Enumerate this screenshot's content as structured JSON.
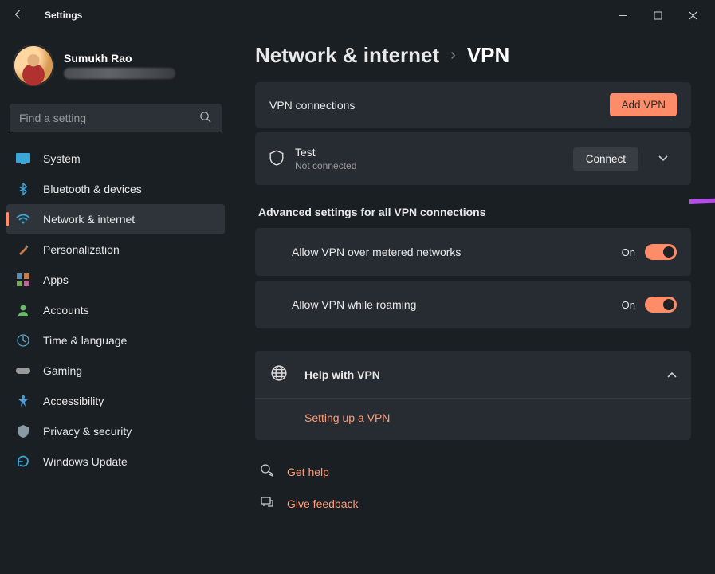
{
  "window": {
    "title": "Settings"
  },
  "profile": {
    "name": "Sumukh Rao"
  },
  "search": {
    "placeholder": "Find a setting"
  },
  "sidebar": {
    "items": [
      {
        "label": "System",
        "icon": "monitor"
      },
      {
        "label": "Bluetooth & devices",
        "icon": "bluetooth"
      },
      {
        "label": "Network & internet",
        "icon": "wifi",
        "active": true
      },
      {
        "label": "Personalization",
        "icon": "brush"
      },
      {
        "label": "Apps",
        "icon": "apps"
      },
      {
        "label": "Accounts",
        "icon": "person"
      },
      {
        "label": "Time & language",
        "icon": "globe"
      },
      {
        "label": "Gaming",
        "icon": "gamepad"
      },
      {
        "label": "Accessibility",
        "icon": "accessibility"
      },
      {
        "label": "Privacy & security",
        "icon": "shield"
      },
      {
        "label": "Windows Update",
        "icon": "update"
      }
    ]
  },
  "breadcrumb": {
    "parent": "Network & internet",
    "current": "VPN"
  },
  "vpn": {
    "connections_header": "VPN connections",
    "add_button": "Add VPN",
    "item": {
      "name": "Test",
      "status": "Not connected",
      "connect_label": "Connect"
    }
  },
  "advanced": {
    "title": "Advanced settings for all VPN connections",
    "metered": {
      "label": "Allow VPN over metered networks",
      "state": "On"
    },
    "roaming": {
      "label": "Allow VPN while roaming",
      "state": "On"
    }
  },
  "help": {
    "title": "Help with VPN",
    "link": "Setting up a VPN"
  },
  "footer": {
    "get_help": "Get help",
    "feedback": "Give feedback"
  },
  "colors": {
    "accent": "#ff8c69"
  }
}
